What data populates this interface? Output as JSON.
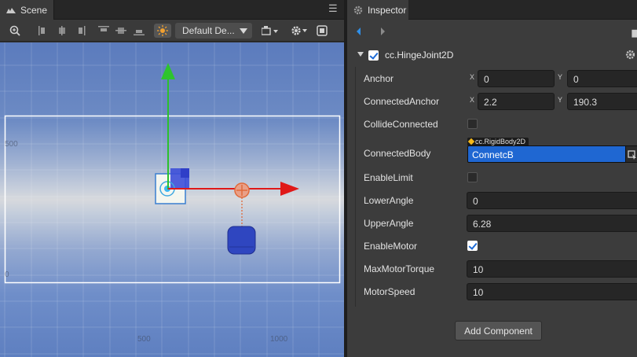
{
  "scene_panel": {
    "tab_label": "Scene",
    "camera_dropdown": "Default De...",
    "axis_labels": {
      "y_500": "500",
      "y_0": "0",
      "x_500": "500",
      "x_1000": "1000"
    }
  },
  "inspector": {
    "tab_label": "Inspector",
    "component": {
      "title": "cc.HingeJoint2D",
      "enabled": true,
      "anchor": {
        "label": "Anchor",
        "x_tag": "X",
        "y_tag": "Y",
        "x": "0",
        "y": "0"
      },
      "connected_anchor": {
        "label": "ConnectedAnchor",
        "x_tag": "X",
        "y_tag": "Y",
        "x": "2.2",
        "y": "190.3"
      },
      "collide_connected": {
        "label": "CollideConnected",
        "checked": false
      },
      "connected_body": {
        "label": "ConnectedBody",
        "type": "cc.RigidBody2D",
        "value": "ConnetcB"
      },
      "enable_limit": {
        "label": "EnableLimit",
        "checked": false
      },
      "lower_angle": {
        "label": "LowerAngle",
        "value": "0"
      },
      "upper_angle": {
        "label": "UpperAngle",
        "value": "6.28"
      },
      "enable_motor": {
        "label": "EnableMotor",
        "checked": true
      },
      "max_motor_torque": {
        "label": "MaxMotorTorque",
        "value": "10"
      },
      "motor_speed": {
        "label": "MotorSpeed",
        "value": "10"
      }
    },
    "add_component_label": "Add Component"
  },
  "colors": {
    "accent_blue": "#1f67d2",
    "gizmo_green": "#2fbf2f",
    "gizmo_red": "#e01818",
    "anchor_orange": "#e06a3a"
  }
}
